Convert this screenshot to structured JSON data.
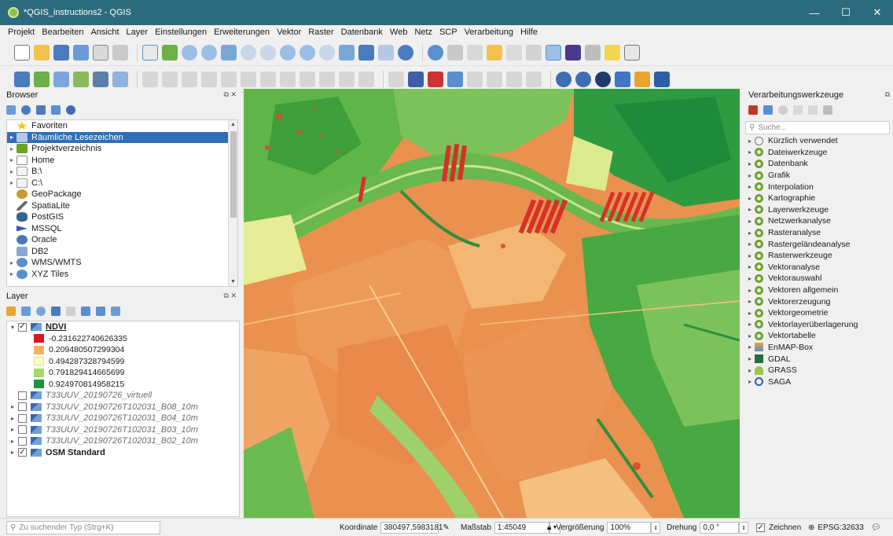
{
  "window": {
    "title": "*QGIS_instructions2 - QGIS",
    "controls": [
      "—",
      "☐",
      "✕"
    ]
  },
  "menu": [
    "Projekt",
    "Bearbeiten",
    "Ansicht",
    "Layer",
    "Einstellungen",
    "Erweiterungen",
    "Vektor",
    "Raster",
    "Datenbank",
    "Web",
    "Netz",
    "SCP",
    "Verarbeitung",
    "Hilfe"
  ],
  "browser": {
    "title": "Browser",
    "items": [
      {
        "label": "Favoriten",
        "expander": "",
        "icon": "star-icon",
        "selected": false
      },
      {
        "label": "Räumliche Lesezeichen",
        "expander": "▸",
        "icon": "bookmark-icon",
        "selected": true
      },
      {
        "label": "Projektverzeichnis",
        "expander": "▸",
        "icon": "project-folder-icon",
        "selected": false
      },
      {
        "label": "Home",
        "expander": "▸",
        "icon": "home-folder-icon",
        "selected": false
      },
      {
        "label": "B:\\",
        "expander": "▸",
        "icon": "drive-icon",
        "selected": false
      },
      {
        "label": "C:\\",
        "expander": "▸",
        "icon": "drive-icon",
        "selected": false
      },
      {
        "label": "GeoPackage",
        "expander": "",
        "icon": "geopackage-icon",
        "selected": false
      },
      {
        "label": "SpatiaLite",
        "expander": "",
        "icon": "spatialite-icon",
        "selected": false
      },
      {
        "label": "PostGIS",
        "expander": "",
        "icon": "postgis-icon",
        "selected": false
      },
      {
        "label": "MSSQL",
        "expander": "",
        "icon": "mssql-icon",
        "selected": false
      },
      {
        "label": "Oracle",
        "expander": "",
        "icon": "oracle-icon",
        "selected": false
      },
      {
        "label": "DB2",
        "expander": "",
        "icon": "db2-icon",
        "selected": false
      },
      {
        "label": "WMS/WMTS",
        "expander": "▸",
        "icon": "wms-icon",
        "selected": false
      },
      {
        "label": "XYZ Tiles",
        "expander": "▸",
        "icon": "xyz-icon",
        "selected": false
      }
    ]
  },
  "layers": {
    "title": "Layer",
    "ndvi": {
      "name": "NDVI",
      "legend": [
        {
          "value": "-0.231622740626335",
          "color": "#d7191c"
        },
        {
          "value": "0.209480507299304",
          "color": "#fdae61"
        },
        {
          "value": "0.494287328794599",
          "color": "#ffffc0"
        },
        {
          "value": "0.791829414665699",
          "color": "#a6d96a"
        },
        {
          "value": "0.924970814958215",
          "color": "#1a9641"
        }
      ]
    },
    "others": [
      {
        "name": "T33UUV_20190726_virtuell",
        "checked": false,
        "expander": ""
      },
      {
        "name": "T33UUV_20190726T102031_B08_10m",
        "checked": false,
        "expander": "▸"
      },
      {
        "name": "T33UUV_20190726T102031_B04_10m",
        "checked": false,
        "expander": "▸"
      },
      {
        "name": "T33UUV_20190726T102031_B03_10m",
        "checked": false,
        "expander": "▸"
      },
      {
        "name": "T33UUV_20190726T102031_B02_10m",
        "checked": false,
        "expander": "▸"
      }
    ],
    "osm": {
      "name": "OSM Standard",
      "checked": true
    }
  },
  "processing": {
    "title": "Verarbeitungswerkzeuge",
    "search_placeholder": "Suche...",
    "items": [
      {
        "label": "Kürzlich verwendet",
        "icon": "clock-icon"
      },
      {
        "label": "Dateiwerkzeuge",
        "icon": "qgis-icon"
      },
      {
        "label": "Datenbank",
        "icon": "qgis-icon"
      },
      {
        "label": "Grafik",
        "icon": "qgis-icon"
      },
      {
        "label": "Interpolation",
        "icon": "qgis-icon"
      },
      {
        "label": "Kartographie",
        "icon": "qgis-icon"
      },
      {
        "label": "Layerwerkzeuge",
        "icon": "qgis-icon"
      },
      {
        "label": "Netzwerkanalyse",
        "icon": "qgis-icon"
      },
      {
        "label": "Rasteranalyse",
        "icon": "qgis-icon"
      },
      {
        "label": "Rastergeländeanalyse",
        "icon": "qgis-icon"
      },
      {
        "label": "Rasterwerkzeuge",
        "icon": "qgis-icon"
      },
      {
        "label": "Vektoranalyse",
        "icon": "qgis-icon"
      },
      {
        "label": "Vektorauswahl",
        "icon": "qgis-icon"
      },
      {
        "label": "Vektoren allgemein",
        "icon": "qgis-icon"
      },
      {
        "label": "Vektorerzeugung",
        "icon": "qgis-icon"
      },
      {
        "label": "Vektorgeometrie",
        "icon": "qgis-icon"
      },
      {
        "label": "Vektorlayerüberlagerung",
        "icon": "qgis-icon"
      },
      {
        "label": "Vektortabelle",
        "icon": "qgis-icon"
      },
      {
        "label": "EnMAP-Box",
        "icon": "enmap-icon"
      },
      {
        "label": "GDAL",
        "icon": "gdal-icon"
      },
      {
        "label": "GRASS",
        "icon": "grass-icon"
      },
      {
        "label": "SAGA",
        "icon": "saga-icon"
      }
    ]
  },
  "status": {
    "locator_placeholder": "Zu suchender Typ (Strg+K)",
    "coord_label": "Koordinate",
    "coord_value": "380497,5983181",
    "scale_label": "Maßstab",
    "scale_value": "1:45049",
    "magnifier_label": "Vergrößerung",
    "magnifier_value": "100%",
    "rotation_label": "Drehung",
    "rotation_value": "0,0 °",
    "render_label": "Zeichnen",
    "crs": "EPSG:32633"
  },
  "colors": {
    "titlebar": "#2c6b7d",
    "selection": "#2f6fb5",
    "qgis_green": "#6aa428"
  }
}
